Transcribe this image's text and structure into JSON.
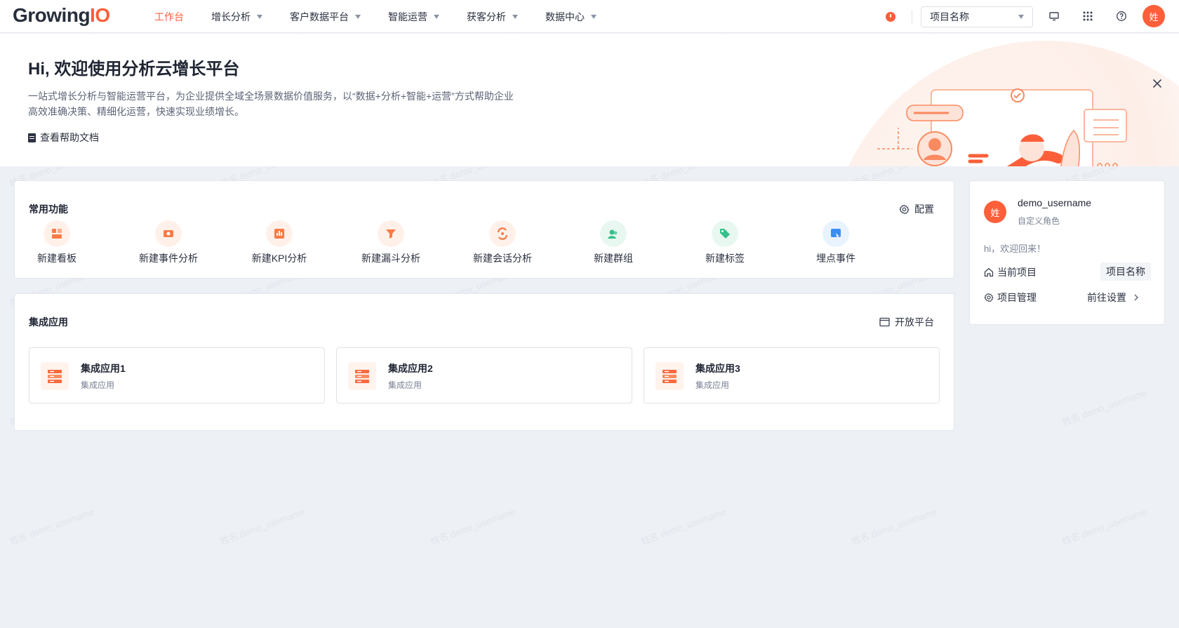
{
  "brand": {
    "logo_main": "Growing",
    "logo_accent": "IO",
    "accent_color": "#fc5f3a"
  },
  "nav": {
    "items": [
      {
        "label": "工作台",
        "active": true,
        "has_caret": false
      },
      {
        "label": "增长分析",
        "active": false,
        "has_caret": true
      },
      {
        "label": "客户数据平台",
        "active": false,
        "has_caret": true
      },
      {
        "label": "智能运营",
        "active": false,
        "has_caret": true
      },
      {
        "label": "获客分析",
        "active": false,
        "has_caret": true
      },
      {
        "label": "数据中心",
        "active": false,
        "has_caret": true
      }
    ]
  },
  "header": {
    "project_select_value": "项目名称",
    "avatar_text": "姓",
    "icons": [
      "clock-icon",
      "monitor-icon",
      "apps-grid-icon",
      "help-icon"
    ]
  },
  "banner": {
    "title": "Hi, 欢迎使用分析云增长平台",
    "description_line1": "一站式增长分析与智能运营平台，为企业提供全域全场景数据价值服务，以“数据+分析+智能+运营”方式帮助企业",
    "description_line2": "高效准确决策、精细化运营，快速实现业绩增长。",
    "help_link": "查看帮助文档"
  },
  "functions": {
    "title": "常用功能",
    "config_label": "配置",
    "items": [
      {
        "label": "新建看板",
        "icon": "dashboard-icon",
        "bg": "#fff1ea",
        "fg": "#fb7a45"
      },
      {
        "label": "新建事件分析",
        "icon": "event-analysis-icon",
        "bg": "#fff1ea",
        "fg": "#fb7a45"
      },
      {
        "label": "新建KPI分析",
        "icon": "kpi-analysis-icon",
        "bg": "#fff1ea",
        "fg": "#fb7a45"
      },
      {
        "label": "新建漏斗分析",
        "icon": "funnel-analysis-icon",
        "bg": "#fff1ea",
        "fg": "#fb7a45"
      },
      {
        "label": "新建会话分析",
        "icon": "session-analysis-icon",
        "bg": "#fff1ea",
        "fg": "#fb7a45"
      },
      {
        "label": "新建群组",
        "icon": "user-group-icon",
        "bg": "#e8f8f0",
        "fg": "#34c08a"
      },
      {
        "label": "新建标签",
        "icon": "tag-icon",
        "bg": "#e8f8f0",
        "fg": "#34c08a"
      },
      {
        "label": "埋点事件",
        "icon": "tracking-event-icon",
        "bg": "#e9f3ff",
        "fg": "#3a8ef6"
      }
    ]
  },
  "integrations": {
    "title": "集成应用",
    "open_platform_label": "开放平台",
    "apps": [
      {
        "name": "集成应用1",
        "sub": "集成应用"
      },
      {
        "name": "集成应用2",
        "sub": "集成应用"
      },
      {
        "name": "集成应用3",
        "sub": "集成应用"
      }
    ]
  },
  "user_panel": {
    "avatar_text": "姓",
    "username": "demo_username",
    "role": "自定义角色",
    "welcome": "hi，欢迎回来！",
    "current_project_label": "当前项目",
    "current_project_value": "项目名称",
    "project_manage_label": "项目管理",
    "settings_link": "前往设置"
  },
  "watermark": {
    "text": "姓名 demo_username"
  }
}
